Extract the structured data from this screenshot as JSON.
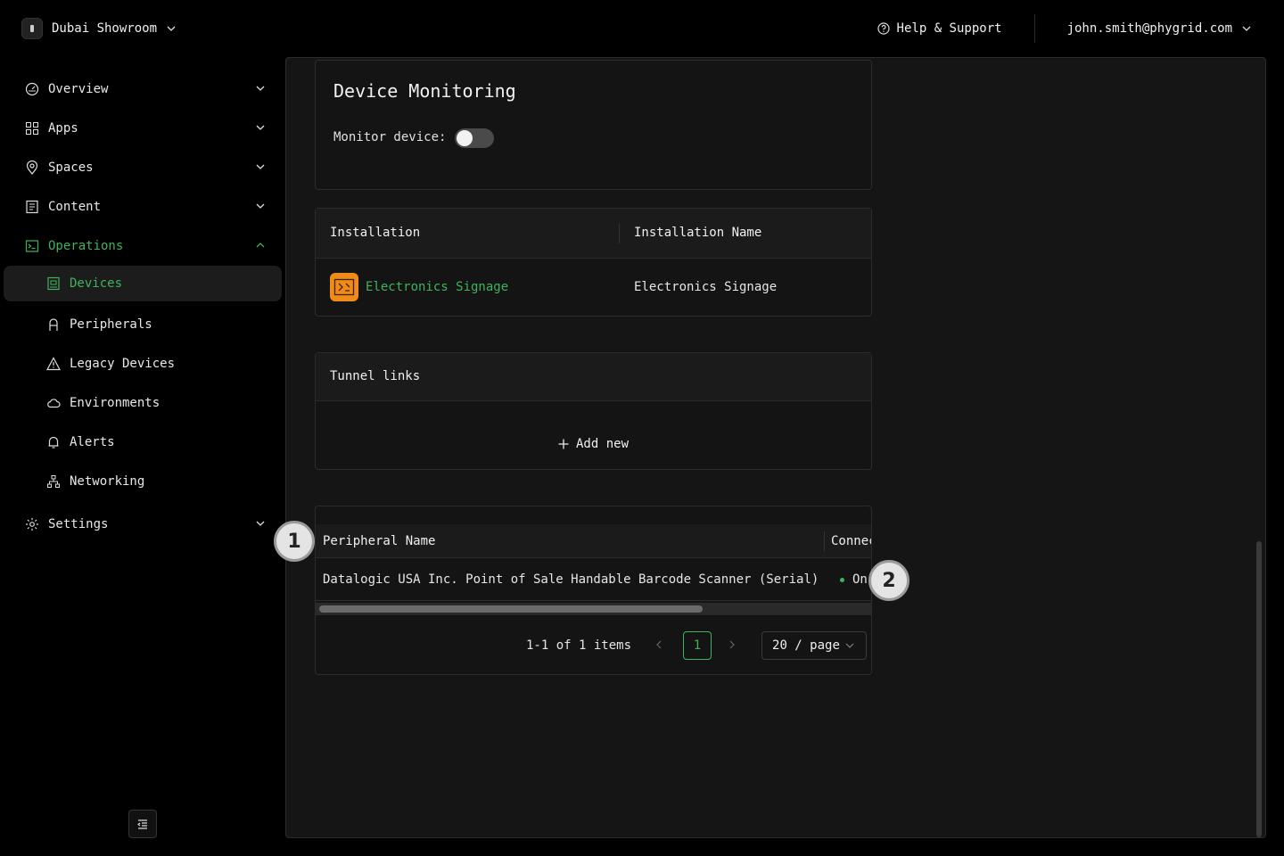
{
  "header": {
    "org_name": "Dubai Showroom",
    "help_label": "Help & Support",
    "user_email": "john.smith@phygrid.com"
  },
  "sidebar": {
    "items": [
      {
        "label": "Overview",
        "icon": "gauge-icon"
      },
      {
        "label": "Apps",
        "icon": "grid-icon"
      },
      {
        "label": "Spaces",
        "icon": "location-pin-icon"
      },
      {
        "label": "Content",
        "icon": "document-icon"
      },
      {
        "label": "Operations",
        "icon": "terminal-icon"
      }
    ],
    "operations_sub": [
      {
        "label": "Devices",
        "icon": "device-icon"
      },
      {
        "label": "Peripherals",
        "icon": "peripheral-icon"
      },
      {
        "label": "Legacy Devices",
        "icon": "warning-icon"
      },
      {
        "label": "Environments",
        "icon": "cloud-icon"
      },
      {
        "label": "Alerts",
        "icon": "bell-icon"
      },
      {
        "label": "Networking",
        "icon": "network-icon"
      }
    ],
    "settings_label": "Settings"
  },
  "monitoring": {
    "title": "Device Monitoring",
    "monitor_label": "Monitor device:",
    "monitor_enabled": false
  },
  "installation_table": {
    "columns": [
      "Installation",
      "Installation Name"
    ],
    "rows": [
      {
        "installation": "Electronics Signage",
        "name": "Electronics Signage"
      }
    ]
  },
  "tunnel_links": {
    "title": "Tunnel links",
    "add_label": "Add new"
  },
  "peripherals_table": {
    "columns": [
      "Peripheral Name",
      "Connec"
    ],
    "rows": [
      {
        "name": "Datalogic USA Inc. Point of Sale Handable Barcode Scanner (Serial)",
        "status": "On"
      }
    ],
    "pagination": {
      "summary": "1-1 of 1 items",
      "current_page": "1",
      "page_size": "20 / page"
    }
  },
  "markers": [
    "1",
    "2"
  ],
  "colors": {
    "accent": "#3fb35b",
    "app_icon": "#f08a18"
  }
}
